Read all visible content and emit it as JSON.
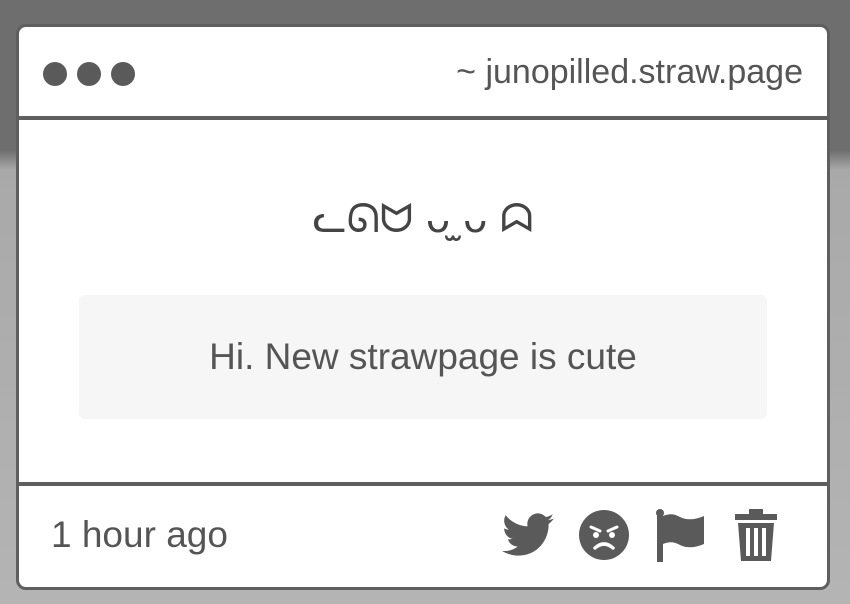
{
  "window": {
    "url": "~ junopilled.straw.page"
  },
  "post": {
    "emoticon": "ᓚᘏᗢ ᴗ ̫ᴗ ᗣ",
    "message": "Hi. New strawpage is cute",
    "timestamp": "1 hour ago"
  },
  "actions": {
    "icons": [
      "twitter-icon",
      "angry-face-icon",
      "flag-icon",
      "trash-icon"
    ]
  },
  "colors": {
    "frame": "#5f5f5f",
    "icon": "#5a5a5a",
    "text": "#555555"
  }
}
